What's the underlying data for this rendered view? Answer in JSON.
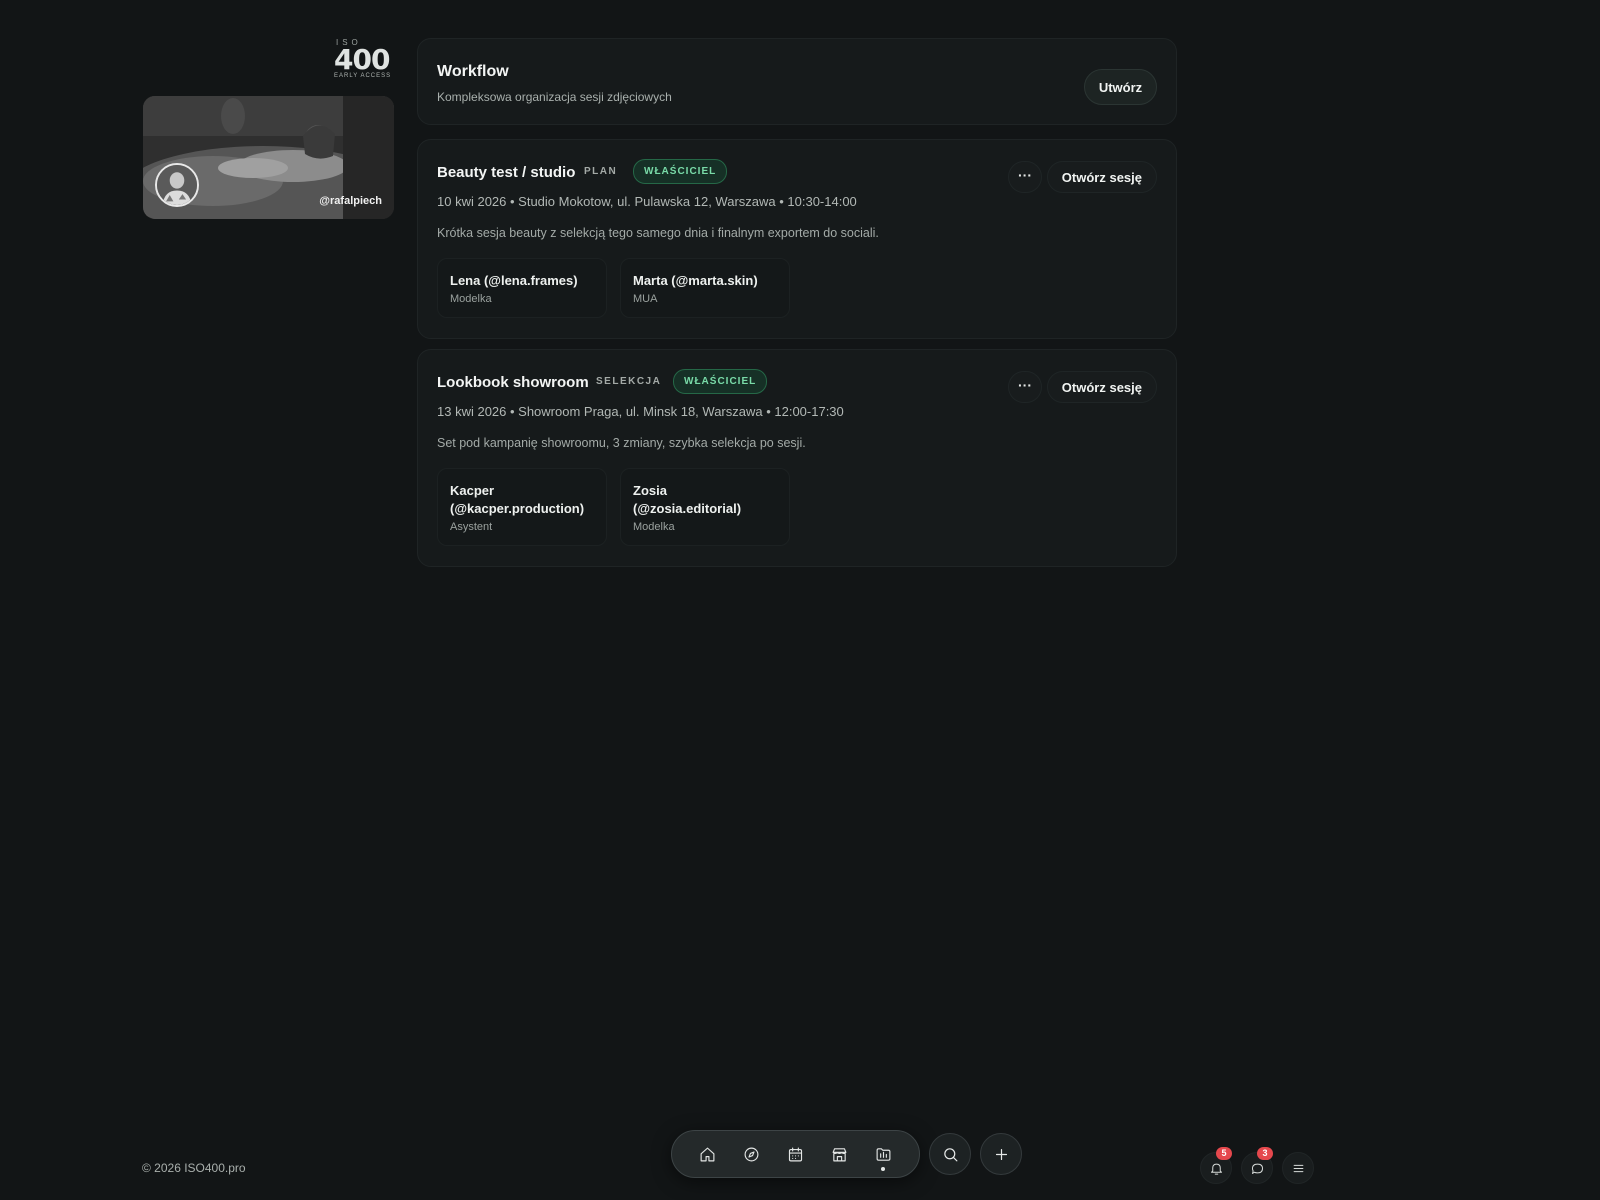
{
  "brand": {
    "top": "ISO",
    "number": "400",
    "tagline": "EARLY ACCESS"
  },
  "profile": {
    "handle": "@rafalpiech"
  },
  "workflow": {
    "title": "Workflow",
    "subtitle": "Kompleksowa organizacja sesji zdjęciowych",
    "create_label": "Utwórz"
  },
  "sessions": [
    {
      "title": "Beauty test / studio",
      "status": "PLAN",
      "role": "WŁAŚCICIEL",
      "meta": "10 kwi 2026 • Studio Mokotow, ul. Pulawska 12, Warszawa • 10:30-14:00",
      "description": "Krótka sesja beauty z selekcją tego samego dnia i finalnym exportem do sociali.",
      "more_label": "···",
      "open_label": "Otwórz sesję",
      "crew": [
        {
          "name": "Lena (@lena.frames)",
          "role": "Modelka"
        },
        {
          "name": "Marta (@marta.skin)",
          "role": "MUA"
        }
      ]
    },
    {
      "title": "Lookbook showroom",
      "status": "SELEKCJA",
      "role": "WŁAŚCICIEL",
      "meta": "13 kwi 2026 • Showroom Praga, ul. Minsk 18, Warszawa • 12:00-17:30",
      "description": "Set pod kampanię showroomu, 3 zmiany, szybka selekcja po sesji.",
      "more_label": "···",
      "open_label": "Otwórz sesję",
      "crew": [
        {
          "name": "Kacper (@kacper.production)",
          "role": "Asystent"
        },
        {
          "name": "Zosia (@zosia.editorial)",
          "role": "Modelka"
        }
      ]
    }
  ],
  "footer": {
    "copyright": "© 2026 ISO400.pro"
  },
  "dock": {
    "items": [
      "home-icon",
      "compass-icon",
      "calendar-icon",
      "store-icon",
      "workflow-icon"
    ],
    "active": "workflow-icon"
  },
  "notifications": {
    "count": "5"
  },
  "messages": {
    "count": "3"
  },
  "colors": {
    "background": "#121516",
    "accent": "#79dba8",
    "badge": "#e5484d"
  }
}
